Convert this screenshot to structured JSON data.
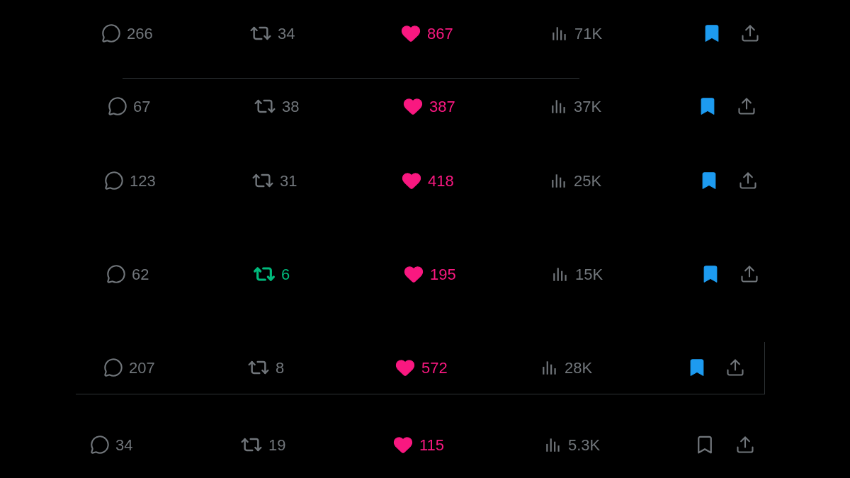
{
  "posts": [
    {
      "replies": "266",
      "reposts": "34",
      "reposted": false,
      "likes": "867",
      "liked": true,
      "views": "71K",
      "bookmarked": true
    },
    {
      "replies": "67",
      "reposts": "38",
      "reposted": false,
      "likes": "387",
      "liked": true,
      "views": "37K",
      "bookmarked": true
    },
    {
      "replies": "123",
      "reposts": "31",
      "reposted": false,
      "likes": "418",
      "liked": true,
      "views": "25K",
      "bookmarked": true
    },
    {
      "replies": "62",
      "reposts": "6",
      "reposted": true,
      "likes": "195",
      "liked": true,
      "views": "15K",
      "bookmarked": true
    },
    {
      "replies": "207",
      "reposts": "8",
      "reposted": false,
      "likes": "572",
      "liked": true,
      "views": "28K",
      "bookmarked": true
    },
    {
      "replies": "34",
      "reposts": "19",
      "reposted": false,
      "likes": "115",
      "liked": true,
      "views": "5.3K",
      "bookmarked": false
    }
  ]
}
